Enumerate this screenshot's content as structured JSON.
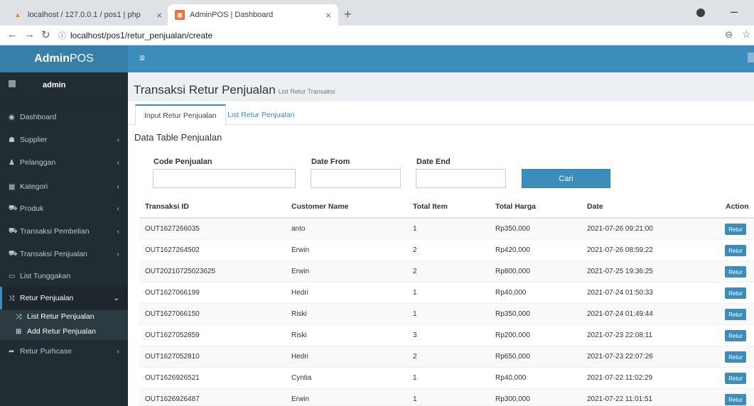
{
  "browser": {
    "tabs": [
      {
        "title": "localhost / 127.0.0.1 / pos1 | php"
      },
      {
        "title": "AdminPOS | Dashboard"
      }
    ],
    "url": "localhost/pos1/retur_penjualan/create"
  },
  "header": {
    "logo_bold": "Admin",
    "logo_rest": "POS"
  },
  "user": {
    "name": "admin"
  },
  "sidebar": {
    "items": [
      {
        "label": "Dashboard",
        "icon": "dashboard-icon"
      },
      {
        "label": "Supplier",
        "icon": "users-icon"
      },
      {
        "label": "Pelanggan",
        "icon": "user-icon"
      },
      {
        "label": "Kategori",
        "icon": "grid-icon"
      },
      {
        "label": "Produk",
        "icon": "cart-icon"
      },
      {
        "label": "Transaksi Pembelian",
        "icon": "cart-icon"
      },
      {
        "label": "Transaksi Penjualan",
        "icon": "cart-icon"
      },
      {
        "label": "List Tunggakan",
        "icon": "card-icon"
      },
      {
        "label": "Retur Penjualan",
        "icon": "random-icon"
      },
      {
        "label": "Retur Purhcase",
        "icon": "share-icon"
      }
    ],
    "submenu": [
      {
        "label": "List Retur Penjualan",
        "icon": "random-icon"
      },
      {
        "label": "Add Retur Penjualan",
        "icon": "plus-square-icon"
      }
    ]
  },
  "page": {
    "title": "Transaksi Retur Penjualan",
    "subtitle": "List Retur Transaksi",
    "tabs": [
      "Input Retur Penjualan",
      "List Retur Penjualan"
    ],
    "section_title": "Data Table Penjualan"
  },
  "filters": {
    "code_label": "Code Penjualan",
    "date_from_label": "Date From",
    "date_end_label": "Date End",
    "button": "Cari"
  },
  "table": {
    "headers": [
      "Transaksi ID",
      "Customer Name",
      "Total Item",
      "Total Harga",
      "Date",
      "Action"
    ],
    "rows": [
      {
        "id": "OUT1627266035",
        "customer": "anto",
        "items": "1",
        "harga": "Rp350,000",
        "date": "2021-07-26 09:21:00",
        "action": "Retur"
      },
      {
        "id": "OUT1627264502",
        "customer": "Erwin",
        "items": "2",
        "harga": "Rp420,000",
        "date": "2021-07-26 08:59:22",
        "action": "Retur"
      },
      {
        "id": "OUT20210725023625",
        "customer": "Erwin",
        "items": "2",
        "harga": "Rp800,000",
        "date": "2021-07-25 19:36:25",
        "action": "Retur"
      },
      {
        "id": "OUT1627066199",
        "customer": "Hedri",
        "items": "1",
        "harga": "Rp40,000",
        "date": "2021-07-24 01:50:33",
        "action": "Retur"
      },
      {
        "id": "OUT1627066150",
        "customer": "Riski",
        "items": "1",
        "harga": "Rp350,000",
        "date": "2021-07-24 01:49:44",
        "action": "Retur"
      },
      {
        "id": "OUT1627052859",
        "customer": "Riski",
        "items": "3",
        "harga": "Rp200,000",
        "date": "2021-07-23 22:08:11",
        "action": "Retur"
      },
      {
        "id": "OUT1627052810",
        "customer": "Hedri",
        "items": "2",
        "harga": "Rp650,000",
        "date": "2021-07-23 22:07:26",
        "action": "Retur"
      },
      {
        "id": "OUT1626926521",
        "customer": "Cyntia",
        "items": "1",
        "harga": "Rp40,000",
        "date": "2021-07-22 11:02:29",
        "action": "Retur"
      },
      {
        "id": "OUT1626926487",
        "customer": "Erwin",
        "items": "1",
        "harga": "Rp300,000",
        "date": "2021-07-22 11:01:51",
        "action": "Retur"
      }
    ]
  }
}
